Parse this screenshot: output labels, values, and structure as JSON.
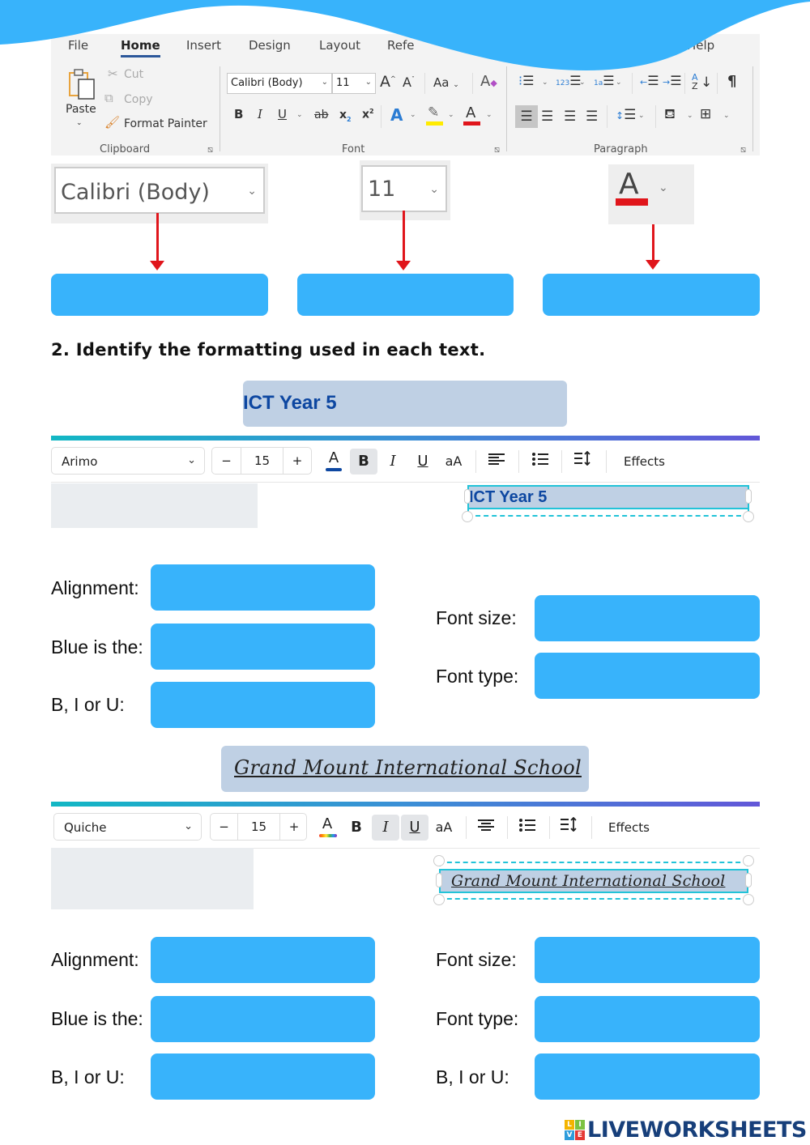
{
  "ribbon": {
    "tabs": [
      "File",
      "Home",
      "Insert",
      "Design",
      "Layout",
      "Refe",
      "Help"
    ],
    "active_tab": "Home",
    "clipboard": {
      "paste": "Paste",
      "cut": "Cut",
      "copy": "Copy",
      "format_painter": "Format Painter",
      "group_label": "Clipboard"
    },
    "font": {
      "font_name": "Calibri (Body)",
      "font_size": "11",
      "grow": "A",
      "shrink": "A",
      "change_case": "Aa",
      "bold": "B",
      "italic": "I",
      "underline": "U",
      "strike": "ab",
      "subscript": "x",
      "superscript": "x",
      "text_effects": "A",
      "font_color": "A",
      "group_label": "Font",
      "highlight_color": "#ffeb00",
      "font_color_hex": "#e0151b"
    },
    "paragraph": {
      "sort": "A Z",
      "pilcrow": "¶",
      "group_label": "Paragraph"
    }
  },
  "callouts": {
    "font_name": "Calibri (Body)",
    "font_size": "11",
    "font_color_glyph": "A",
    "font_color_hex": "#e0151b"
  },
  "question": {
    "heading": "2. Identify the formatting used in each text."
  },
  "example1": {
    "sample_text": "ICT Year 5",
    "text_color": "#0d47a1",
    "toolbar": {
      "font": "Arimo",
      "size": "15",
      "minus": "−",
      "plus": "+",
      "color_glyph": "A",
      "color_bar": "#0d47a1",
      "bold": "B",
      "italic": "I",
      "underline": "U",
      "case": "aA",
      "effects": "Effects",
      "active": [
        "bold"
      ]
    },
    "labels": {
      "alignment": "Alignment:",
      "blue_is_the": "Blue is the:",
      "biu": "B, I or U:",
      "font_size": "Font size:",
      "font_type": "Font type:"
    }
  },
  "example2": {
    "sample_text": "Grand Mount International School",
    "toolbar": {
      "font": "Quiche",
      "size": "15",
      "minus": "−",
      "plus": "+",
      "color_glyph": "A",
      "bold": "B",
      "italic": "I",
      "underline": "U",
      "case": "aA",
      "effects": "Effects",
      "active": [
        "italic",
        "underline"
      ]
    },
    "labels": {
      "alignment": "Alignment:",
      "blue_is_the": "Blue is the:",
      "biu": "B, I or U:",
      "font_size": "Font size:",
      "font_type": "Font type:",
      "biu_right": "B, I or U:"
    }
  },
  "footer": {
    "brand": "LIVEWORKSHEETS",
    "blocks": [
      "L",
      "I",
      "V",
      "E"
    ]
  },
  "colors": {
    "answer_box": "#38b3fb",
    "wave": "#38b3fb",
    "arrow": "#e0151b"
  }
}
